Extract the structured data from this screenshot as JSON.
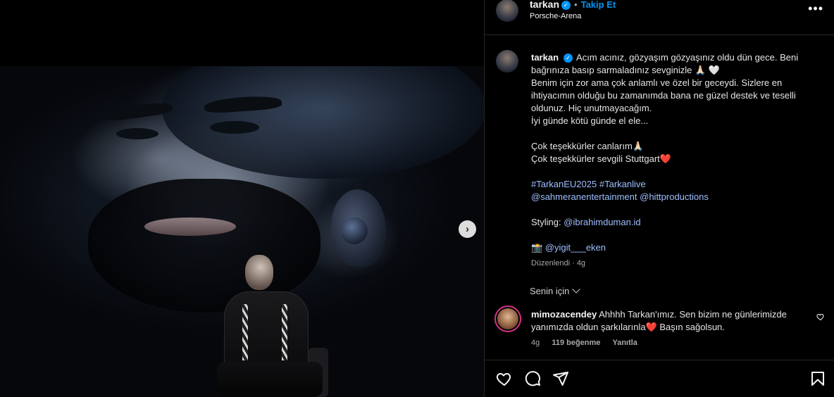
{
  "header": {
    "username": "tarkan",
    "follow_label": "Takip Et",
    "location": "Porsche-Arena",
    "separator": "•"
  },
  "caption": {
    "username": "tarkan",
    "lines": [
      "Acım acınız, gözyaşım gözyaşınız oldu dün gece. Beni bağrınıza basıp sarmaladınız sevginizle 🙏🏻 🤍",
      "Benim için zor ama çok anlamlı ve özel bir geceydi. Sizlere en ihtiyacımın olduğu bu zamanımda bana ne güzel destek ve teselli oldunuz. Hiç unutmayacağım.",
      "İyi günde kötü günde el ele...",
      "",
      "Çok teşekkürler canlarım🙏🏻",
      "Çok teşekkürler sevgili Stuttgart❤️",
      ""
    ],
    "hashtags": [
      "#TarkanEU2025",
      "#Tarkanlive"
    ],
    "mentions": [
      "@sahmeranentertainment",
      "@hittproductions"
    ],
    "styling_label": "Styling:",
    "styling_mention": "@ibrahimduman.id",
    "photo_emoji": "📸",
    "photo_mention": "@yigit___eken",
    "meta": "Düzenlendi · 4g"
  },
  "for_you_label": "Senin için",
  "comment": {
    "username": "mimozacendey",
    "text": "Ahhhh Tarkan'ımız. Sen bizim ne günlerimizde yanımızda oldun şarkılarınla❤️  Başın sağolsun.",
    "age": "4g",
    "likes": "119 beğenme",
    "reply_label": "Yanıtla"
  },
  "icons": {
    "more": "more-horizontal-icon",
    "like": "heart-icon",
    "comment": "comment-icon",
    "share": "send-icon",
    "save": "bookmark-icon",
    "next": "chevron-right-icon"
  },
  "colors": {
    "link": "#0095f6",
    "tag": "#9fbfff",
    "verified": "#0095f6"
  }
}
